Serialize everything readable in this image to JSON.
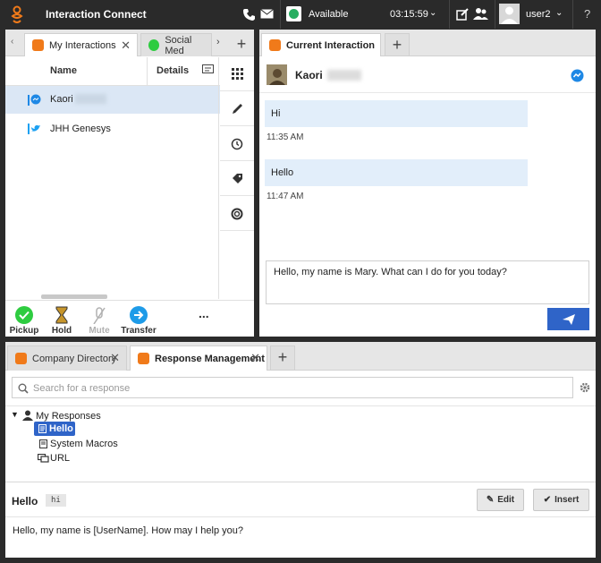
{
  "topbar": {
    "app_title": "Interaction Connect",
    "status": "Available",
    "timer": "03:15:59",
    "user": "user2",
    "help": "?"
  },
  "left_panel": {
    "tabs": [
      {
        "label": "My Interactions",
        "active": true
      },
      {
        "label": "Social Med",
        "active": false
      }
    ],
    "columns": {
      "name": "Name",
      "details": "Details"
    },
    "rows": [
      {
        "name": "Kaori",
        "channel": "messenger",
        "selected": true
      },
      {
        "name": "JHH Genesys",
        "channel": "twitter",
        "selected": false
      }
    ],
    "actions": [
      {
        "label": "Pickup",
        "color": "#2ecc40",
        "enabled": true
      },
      {
        "label": "Hold",
        "color": "#c7962c",
        "enabled": true
      },
      {
        "label": "Mute",
        "color": "#b0b0b0",
        "enabled": false
      },
      {
        "label": "Transfer",
        "color": "#1e9be8",
        "enabled": true
      }
    ],
    "more": "..."
  },
  "right_panel": {
    "tab_label": "Current Interaction",
    "contact_name": "Kaori",
    "messages": [
      {
        "text": "Hi",
        "time": "11:35 AM"
      },
      {
        "text": "Hello",
        "time": "11:47 AM"
      }
    ],
    "draft": "Hello, my name is Mary. What can I do for you today?"
  },
  "bottom_panel": {
    "tabs": [
      {
        "label": "Company Directory",
        "active": false
      },
      {
        "label": "Response Management",
        "active": true
      }
    ],
    "search_placeholder": "Search for a response",
    "tree": {
      "root": "My Responses",
      "items": [
        {
          "label": "Hello",
          "selected": true
        },
        {
          "label": "System Macros",
          "selected": false
        },
        {
          "label": "URL",
          "selected": false
        }
      ]
    },
    "response_title": "Hello",
    "response_tag": "hi",
    "edit_label": "Edit",
    "insert_label": "Insert",
    "response_body": "Hello, my name is [UserName]. How may I help you?"
  },
  "colors": {
    "accent_orange": "#f07a1a",
    "primary_blue": "#2f64c8",
    "selection": "#dbe7f5",
    "bubble": "#e2eefa"
  }
}
